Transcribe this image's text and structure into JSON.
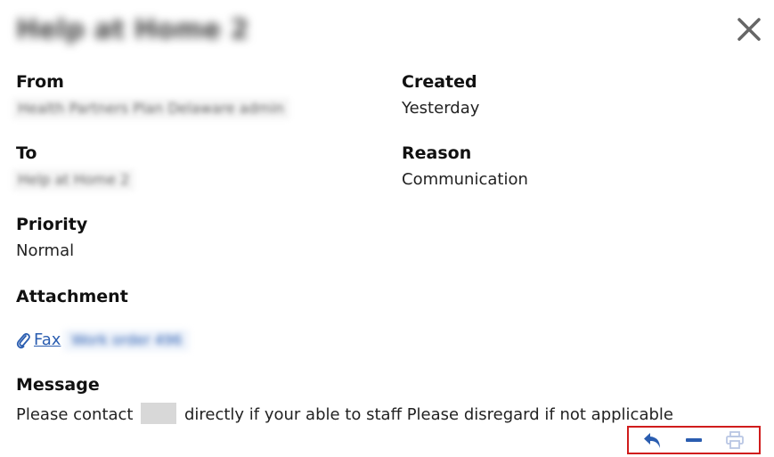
{
  "dialog": {
    "title": "Help at Home 2"
  },
  "fields": {
    "from_label": "From",
    "from_value": "Health Partners Plan Delaware admin",
    "created_label": "Created",
    "created_value": "Yesterday",
    "to_label": "To",
    "to_value": "Help at Home 2",
    "reason_label": "Reason",
    "reason_value": "Communication",
    "priority_label": "Priority",
    "priority_value": "Normal",
    "attachment_label": "Attachment",
    "message_label": "Message"
  },
  "attachment": {
    "link_text": "Fax",
    "link_detail": "Work order 496"
  },
  "message": {
    "before": "Please contact",
    "after": "directly if your able to staff Please disregard if not applicable"
  },
  "icons": {
    "close": "close-icon",
    "paperclip": "paperclip-icon",
    "reply": "reply-icon",
    "minimize": "minus-icon",
    "print": "printer-icon"
  },
  "colors": {
    "link": "#2a5db0",
    "action_icon": "#2a5db0",
    "action_disabled": "#b9c6e4",
    "highlight_border": "#d01c1c",
    "close_icon": "#666666"
  }
}
